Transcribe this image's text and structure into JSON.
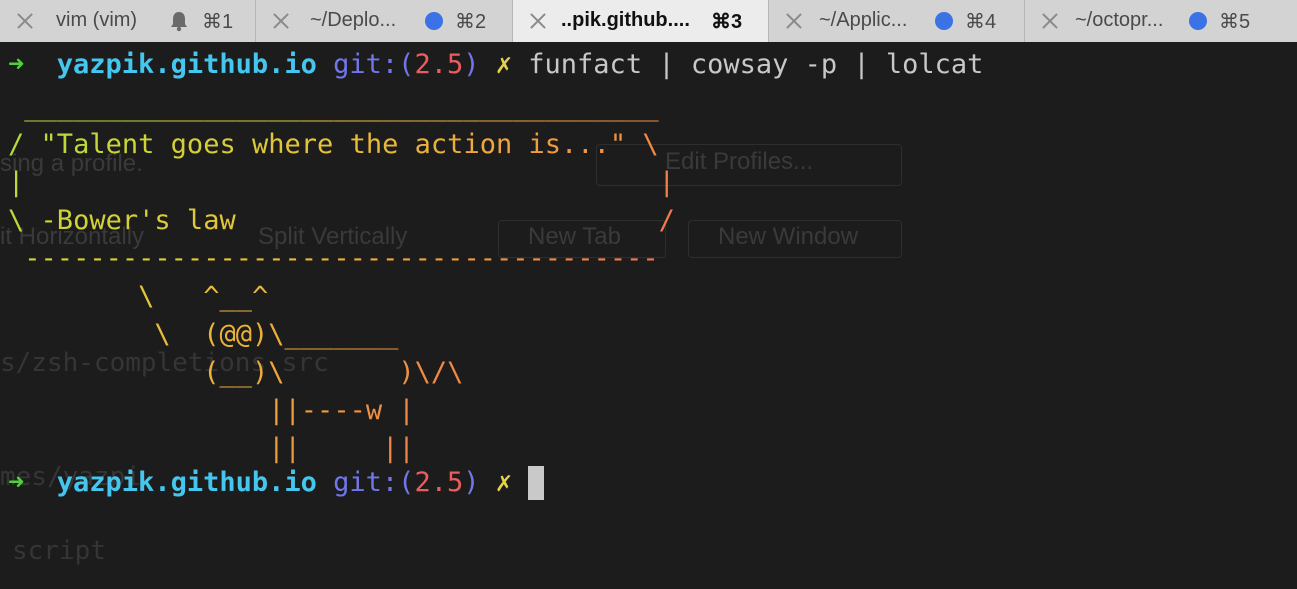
{
  "tabs": [
    {
      "title": "vim (vim)",
      "shortcut": "⌘1",
      "indicator": "bell-icon",
      "active": false
    },
    {
      "title": "~/Deplo...",
      "shortcut": "⌘2",
      "indicator": "activity-dot",
      "active": false
    },
    {
      "title": "..pik.github....",
      "shortcut": "⌘3",
      "indicator": "none",
      "active": true
    },
    {
      "title": "~/Applic...",
      "shortcut": "⌘4",
      "indicator": "activity-dot",
      "active": false
    },
    {
      "title": "~/octopr...",
      "shortcut": "⌘5",
      "indicator": "activity-dot",
      "active": false
    }
  ],
  "prompt": {
    "arrow": "➜",
    "host": "yazpik.github.io",
    "git_label": "git:",
    "open_paren": "(",
    "branch": "2.5",
    "close_paren": ")",
    "dirty_mark": "✗"
  },
  "command": "funfact | cowsay -p | lolcat",
  "cowsay": {
    "lines": [
      " _______________________________________",
      "/ \"Talent goes where the action is...\" \\",
      "|                                       |",
      "\\ -Bower's law                          /",
      " ---------------------------------------",
      "        \\   ^__^",
      "         \\  (@@)\\_______",
      "            (__)\\       )\\/\\",
      "                ||----w |",
      "                ||     ||"
    ]
  },
  "ghost_text": {
    "edit_profiles": "Edit Profiles...",
    "split_horizontally": "it Horizontally",
    "split_vertically": "Split Vertically",
    "new_tab": "New Tab",
    "new_window": "New Window",
    "profile_hint": "sing a profile.",
    "zsh_path": "s/zsh-completions src",
    "mes_path": "mes/yazpi",
    "script": "script"
  },
  "colors": {
    "background": "#1c1c1c",
    "active_tab": "#ececec",
    "inactive_tab": "#d3d3d3",
    "activity_dot": "#3b73e6",
    "prompt_arrow": "#4ed13a",
    "prompt_host": "#45c6ee",
    "prompt_git": "#7177ea",
    "prompt_branch": "#ee5d5d",
    "prompt_dirty": "#e3d24a"
  }
}
